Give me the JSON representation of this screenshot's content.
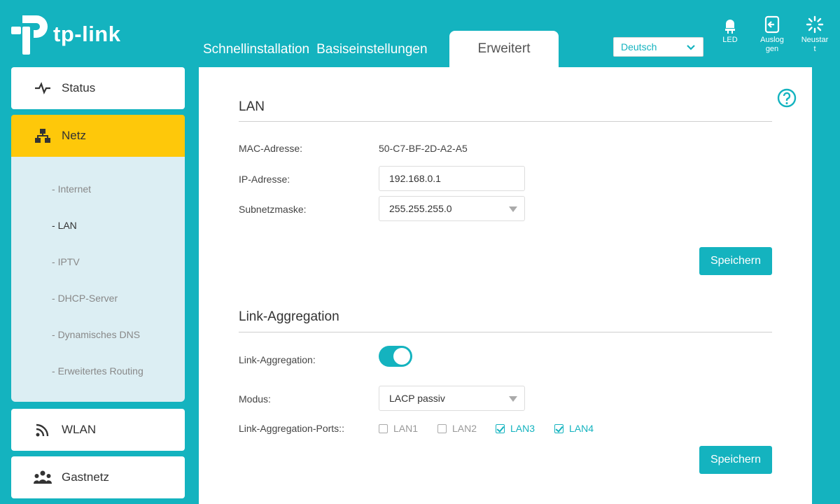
{
  "brand": {
    "name": "tp-link"
  },
  "tabs": [
    {
      "label": "Schnellinstallation"
    },
    {
      "label": "Basiseinstellungen"
    },
    {
      "label": "Erweitert"
    }
  ],
  "language": {
    "selected": "Deutsch"
  },
  "top_buttons": [
    {
      "label": "LED",
      "icon": "bulb-icon"
    },
    {
      "label": "Auslog\ngen",
      "icon": "logout-icon"
    },
    {
      "label": "Neustar\nt",
      "icon": "reboot-icon"
    }
  ],
  "sidebar": {
    "items": [
      {
        "label": "Status",
        "icon": "pulse-icon"
      },
      {
        "label": "Netz",
        "icon": "network-icon"
      },
      {
        "label": "WLAN",
        "icon": "wifi-icon"
      },
      {
        "label": "Gastnetz",
        "icon": "guest-icon"
      }
    ],
    "submenu": [
      {
        "label": "Internet"
      },
      {
        "label": "LAN"
      },
      {
        "label": "IPTV"
      },
      {
        "label": "DHCP-Server"
      },
      {
        "label": "Dynamisches DNS"
      },
      {
        "label": "Erweitertes Routing"
      }
    ]
  },
  "colors": {
    "accent": "#14b3bf",
    "active_nav": "#fec80a",
    "submenu_bg": "#dceef3"
  },
  "lan": {
    "title": "LAN",
    "mac_label": "MAC-Adresse:",
    "mac_value": "50-C7-BF-2D-A2-A5",
    "ip_label": "IP-Adresse:",
    "ip_value": "192.168.0.1",
    "mask_label": "Subnetzmaske:",
    "mask_value": "255.255.255.0",
    "save_label": "Speichern"
  },
  "link_aggregation": {
    "title": "Link-Aggregation",
    "toggle_label": "Link-Aggregation:",
    "enabled": true,
    "mode_label": "Modus:",
    "mode_value": "LACP passiv",
    "ports_label": "Link-Aggregation-Ports::",
    "ports": [
      {
        "label": "LAN1",
        "checked": false
      },
      {
        "label": "LAN2",
        "checked": false
      },
      {
        "label": "LAN3",
        "checked": true
      },
      {
        "label": "LAN4",
        "checked": true
      }
    ],
    "save_label": "Speichern"
  }
}
